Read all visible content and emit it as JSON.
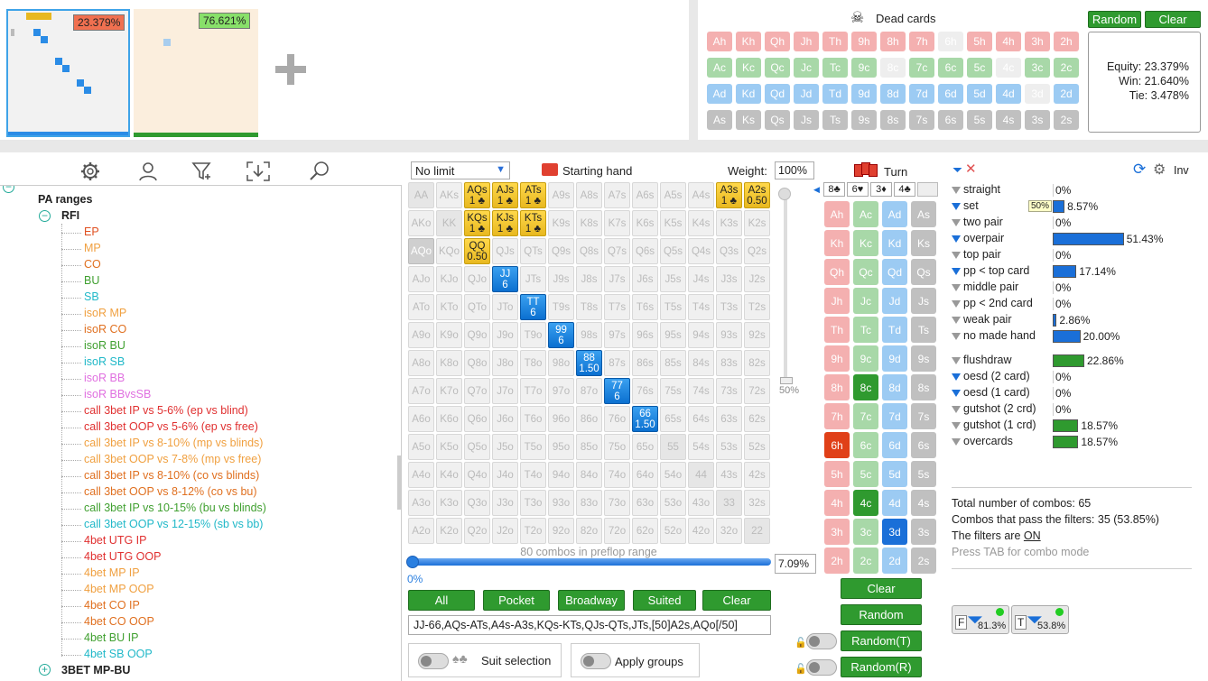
{
  "thumbs": {
    "player1_equity": "23.379%",
    "player2_equity": "76.621%"
  },
  "dead": {
    "title": "Dead cards",
    "random": "Random",
    "clear": "Clear",
    "rows": [
      [
        "Ah",
        "Kh",
        "Qh",
        "Jh",
        "Th",
        "9h",
        "8h",
        "7h",
        "6h",
        "5h",
        "4h",
        "3h",
        "2h"
      ],
      [
        "Ac",
        "Kc",
        "Qc",
        "Jc",
        "Tc",
        "9c",
        "8c",
        "7c",
        "6c",
        "5c",
        "4c",
        "3c",
        "2c"
      ],
      [
        "Ad",
        "Kd",
        "Qd",
        "Jd",
        "Td",
        "9d",
        "8d",
        "7d",
        "6d",
        "5d",
        "4d",
        "3d",
        "2d"
      ],
      [
        "As",
        "Ks",
        "Qs",
        "Js",
        "Ts",
        "9s",
        "8s",
        "7s",
        "6s",
        "5s",
        "4s",
        "3s",
        "2s"
      ]
    ],
    "equity": "Equity: 23.379%",
    "win": "Win: 21.640%",
    "tie": "Tie: 3.478%",
    "colors": {
      "h": "#f4b0b0",
      "c": "#a8d8a8",
      "d": "#9ccbf3",
      "s": "#c0c0c0"
    }
  },
  "tree": {
    "root": "PA ranges",
    "rfi": "RFI",
    "items": [
      {
        "t": "EP",
        "c": "#e05020"
      },
      {
        "t": "MP",
        "c": "#f0a040"
      },
      {
        "t": "CO",
        "c": "#e07020"
      },
      {
        "t": "BU",
        "c": "#40a030"
      },
      {
        "t": "SB",
        "c": "#20b8c8"
      },
      {
        "t": "isoR MP",
        "c": "#f0a040"
      },
      {
        "t": "isoR CO",
        "c": "#e07020"
      },
      {
        "t": "isoR BU",
        "c": "#40a030"
      },
      {
        "t": "isoR SB",
        "c": "#20b8c8"
      },
      {
        "t": "isoR BB",
        "c": "#e070e0"
      },
      {
        "t": "isoR BBvsSB",
        "c": "#e070e0"
      },
      {
        "t": "call 3bet IP vs 5-6% (ep vs blind)",
        "c": "#e03030"
      },
      {
        "t": "call 3bet OOP vs 5-6% (ep vs free)",
        "c": "#e03030"
      },
      {
        "t": "call 3bet IP vs 8-10% (mp vs blinds)",
        "c": "#f0a040"
      },
      {
        "t": "call 3bet OOP vs 7-8% (mp vs free)",
        "c": "#f0a040"
      },
      {
        "t": "call 3bet IP vs 8-10% (co vs blinds)",
        "c": "#e07020"
      },
      {
        "t": "call 3bet OOP vs 8-12% (co vs bu)",
        "c": "#e07020"
      },
      {
        "t": "call 3bet IP vs 10-15% (bu vs blinds)",
        "c": "#40a030"
      },
      {
        "t": "call 3bet OOP vs 12-15% (sb vs bb)",
        "c": "#20b8c8"
      },
      {
        "t": "4bet UTG IP",
        "c": "#e03030"
      },
      {
        "t": "4bet UTG OOP",
        "c": "#e03030"
      },
      {
        "t": "4bet MP IP",
        "c": "#f0a040"
      },
      {
        "t": "4bet MP OOP",
        "c": "#f0a040"
      },
      {
        "t": "4bet CO IP",
        "c": "#e07020"
      },
      {
        "t": "4bet CO OOP",
        "c": "#e07020"
      },
      {
        "t": "4bet BU IP",
        "c": "#40a030"
      },
      {
        "t": "4bet SB OOP",
        "c": "#20b8c8"
      }
    ],
    "next": "3BET MP-BU"
  },
  "matrix": {
    "limit": "No limit",
    "starting_hand": "Starting hand",
    "weight_label": "Weight:",
    "weight": "100%",
    "ranks": [
      "A",
      "K",
      "Q",
      "J",
      "T",
      "9",
      "8",
      "7",
      "6",
      "5",
      "4",
      "3",
      "2"
    ],
    "highlight": {
      "0,2": {
        "k": "y",
        "sub": "1 ♣"
      },
      "0,3": {
        "k": "y",
        "sub": "1 ♣"
      },
      "0,4": {
        "k": "y",
        "sub": "1 ♣"
      },
      "0,11": {
        "k": "y",
        "sub": "1 ♣"
      },
      "0,12": {
        "k": "y",
        "sub": "0.50"
      },
      "1,2": {
        "k": "y",
        "sub": "1 ♣"
      },
      "1,3": {
        "k": "y",
        "sub": "1 ♣"
      },
      "1,4": {
        "k": "y",
        "sub": "1 ♣"
      },
      "2,2": {
        "k": "y",
        "sub": "0.50"
      },
      "3,3": {
        "k": "b",
        "sub": "6"
      },
      "4,4": {
        "k": "b",
        "sub": "6"
      },
      "5,5": {
        "k": "b",
        "sub": "6"
      },
      "6,6": {
        "k": "b",
        "sub": "1.50"
      },
      "7,7": {
        "k": "b",
        "sub": "6"
      },
      "8,8": {
        "k": "b",
        "sub": "1.50"
      },
      "2,0": {
        "k": "g",
        "sub": ""
      }
    },
    "combos_text": "80 combos in preflop range",
    "slider_left": "0%",
    "slider_right": "7.09%",
    "side_pct": "50%",
    "buttons": [
      "All",
      "Pocket",
      "Broadway",
      "Suited",
      "Clear"
    ],
    "range_text": "JJ-66,AQs-ATs,A4s-A3s,KQs-KTs,QJs-QTs,JTs,[50]A2s,AQo[/50]",
    "suit_selection": "Suit selection",
    "apply_groups": "Apply groups"
  },
  "turn": {
    "title": "Turn",
    "board": [
      "8♣",
      "6♥",
      "3♦",
      "4♣"
    ],
    "rows": [
      [
        "Ah",
        "Ac",
        "Ad",
        "As"
      ],
      [
        "Kh",
        "Kc",
        "Kd",
        "Ks"
      ],
      [
        "Qh",
        "Qc",
        "Qd",
        "Qs"
      ],
      [
        "Jh",
        "Jc",
        "Jd",
        "Js"
      ],
      [
        "Th",
        "Tc",
        "Td",
        "Ts"
      ],
      [
        "9h",
        "9c",
        "9d",
        "9s"
      ],
      [
        "8h",
        "8c",
        "8d",
        "8s"
      ],
      [
        "7h",
        "7c",
        "7d",
        "7s"
      ],
      [
        "6h",
        "6c",
        "6d",
        "6s"
      ],
      [
        "5h",
        "5c",
        "5d",
        "5s"
      ],
      [
        "4h",
        "4c",
        "4d",
        "4s"
      ],
      [
        "3h",
        "3c",
        "3d",
        "3s"
      ],
      [
        "2h",
        "2c",
        "2d",
        "2s"
      ]
    ],
    "buttons": [
      "Clear",
      "Random",
      "Random(T)",
      "Random(R)"
    ]
  },
  "stats": {
    "inv": "Inv",
    "made": [
      {
        "l": "straight",
        "v": "0%",
        "w": 0,
        "f": "#999"
      },
      {
        "l": "set",
        "v": "8.57%",
        "w": 0.0857,
        "f": "#1a6fd8",
        "tag": "50%"
      },
      {
        "l": "two pair",
        "v": "0%",
        "w": 0,
        "f": "#999"
      },
      {
        "l": "overpair",
        "v": "51.43%",
        "w": 0.5143,
        "f": "#1a6fd8"
      },
      {
        "l": "top pair",
        "v": "0%",
        "w": 0,
        "f": "#999"
      },
      {
        "l": "pp < top card",
        "v": "17.14%",
        "w": 0.1714,
        "f": "#1a6fd8"
      },
      {
        "l": "middle pair",
        "v": "0%",
        "w": 0,
        "f": "#999"
      },
      {
        "l": "pp < 2nd card",
        "v": "0%",
        "w": 0,
        "f": "#999"
      },
      {
        "l": "weak pair",
        "v": "2.86%",
        "w": 0.0286,
        "f": "#999"
      },
      {
        "l": "no made hand",
        "v": "20.00%",
        "w": 0.2,
        "f": "#999"
      }
    ],
    "draws": [
      {
        "l": "flushdraw",
        "v": "22.86%",
        "w": 0.2286,
        "f": "#999"
      },
      {
        "l": "oesd (2 card)",
        "v": "0%",
        "w": 0,
        "f": "#1a6fd8"
      },
      {
        "l": "oesd (1 card)",
        "v": "0%",
        "w": 0,
        "f": "#1a6fd8"
      },
      {
        "l": "gutshot (2 crd)",
        "v": "0%",
        "w": 0,
        "f": "#999"
      },
      {
        "l": "gutshot (1 crd)",
        "v": "18.57%",
        "w": 0.1857,
        "f": "#999"
      },
      {
        "l": "overcards",
        "v": "18.57%",
        "w": 0.1857,
        "f": "#999"
      }
    ],
    "total": "Total number of combos: 65",
    "pass": "Combos that pass the filters: 35 (53.85%)",
    "filters_on_prefix": "The filters are ",
    "filters_on": "ON",
    "tab_hint": "Press TAB for combo mode",
    "f_badge": "81.3%",
    "t_badge": "53.8%"
  }
}
